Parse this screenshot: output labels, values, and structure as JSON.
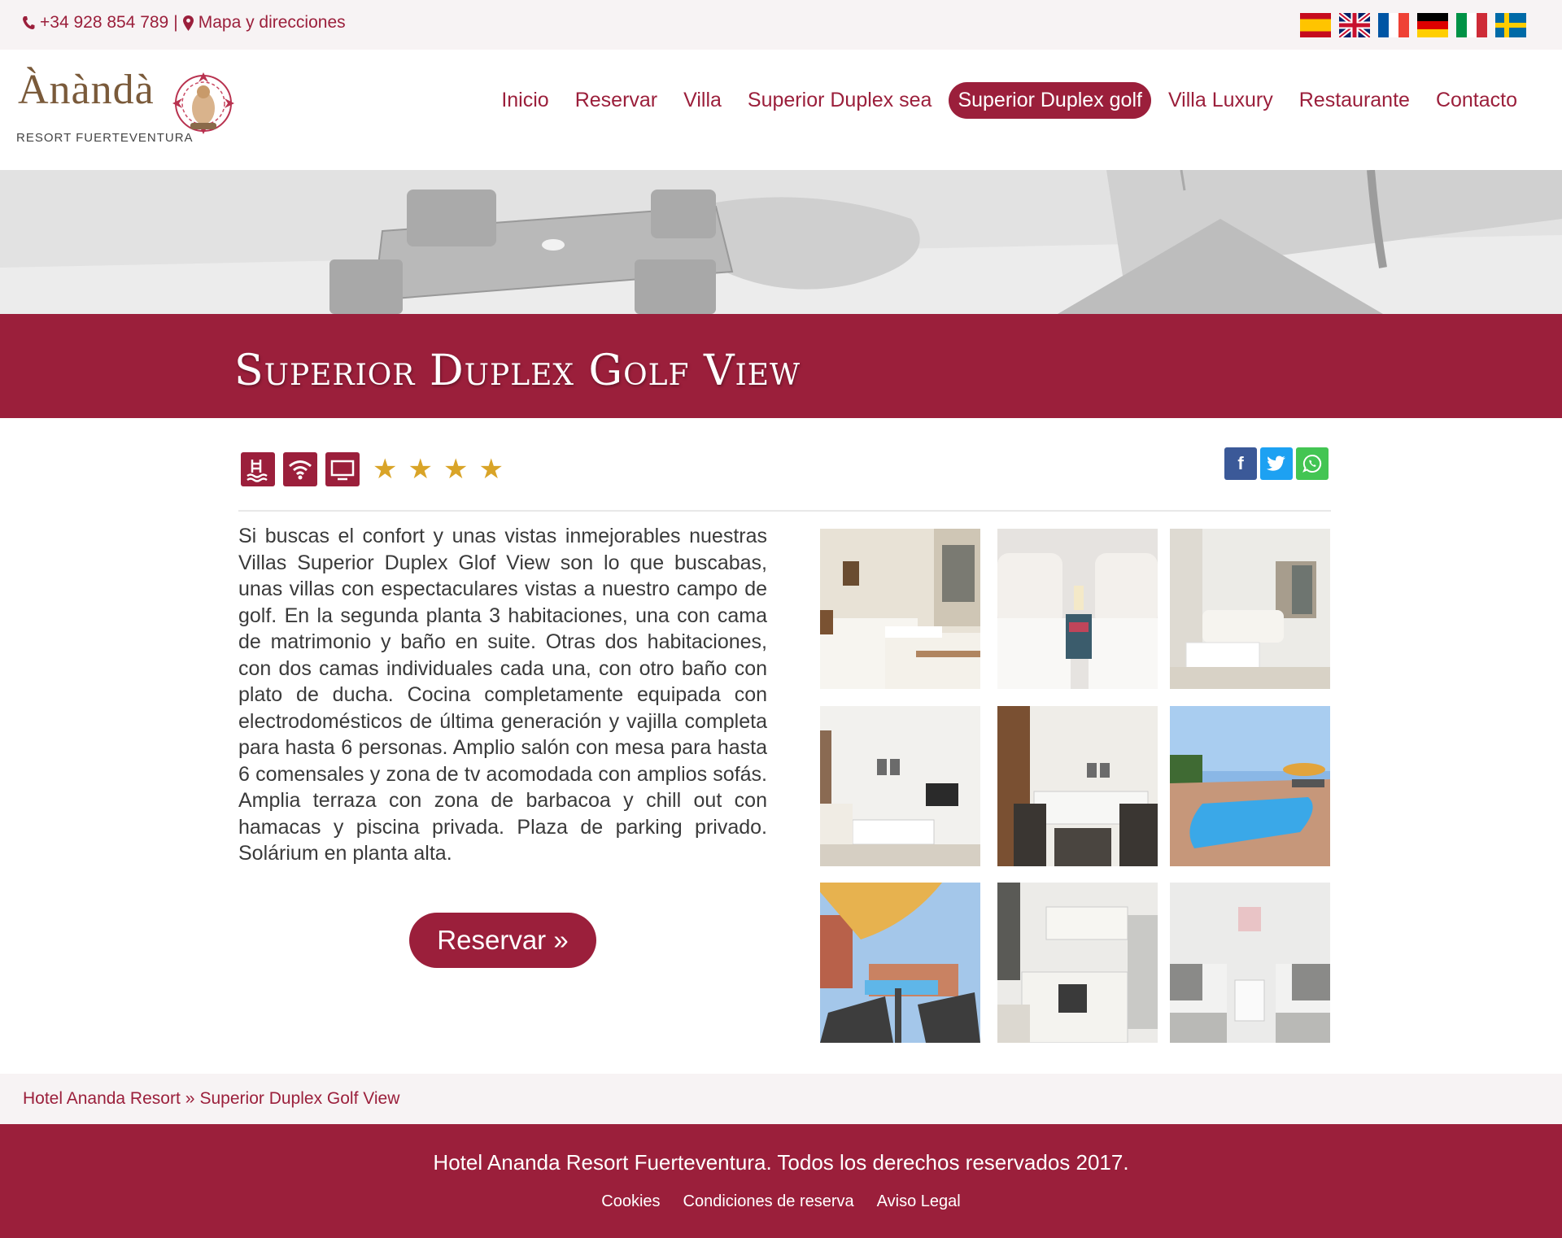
{
  "topbar": {
    "phone": "+34 928 854 789",
    "separator": "|",
    "map_link": "Mapa y direcciones",
    "languages": [
      "es",
      "en",
      "fr",
      "de",
      "it",
      "sv"
    ]
  },
  "logo": {
    "name": "Ànàndà",
    "subtitle": "RESORT FUERTEVENTURA"
  },
  "nav": {
    "items": [
      {
        "label": "Inicio"
      },
      {
        "label": "Reservar"
      },
      {
        "label": "Villa"
      },
      {
        "label": "Superior Duplex sea"
      },
      {
        "label": "Superior Duplex golf"
      },
      {
        "label": "Villa Luxury"
      },
      {
        "label": "Restaurante"
      },
      {
        "label": "Contacto"
      }
    ],
    "active": "Superior Duplex golf"
  },
  "page": {
    "title": "Superior Duplex Golf View",
    "amenities": [
      "pool-icon",
      "wifi-icon",
      "tv-icon"
    ],
    "rating": 4,
    "share": [
      "facebook-icon",
      "twitter-icon",
      "whatsapp-icon"
    ],
    "description": "Si buscas el confort y unas vistas inmejorables nuestras Villas Superior Duplex Glof View son lo que buscabas, unas villas con espectaculares vistas a nuestro campo de golf. En la segunda planta 3 habitaciones, una con cama de matrimonio y baño en suite. Otras dos habitaciones, con dos camas individuales cada una, con otro baño con plato de ducha. Cocina completamente equipada con electrodomésticos de última generación y vajilla completa para hasta 6 personas. Amplio salón con mesa para hasta 6 comensales y zona de tv acomodada con amplios sofás. Amplia terraza con zona de barbacoa y chill out con hamacas y piscina privada. Plaza de parking privado. Solárium en planta alta.",
    "reserve_button": "Reservar »"
  },
  "gallery": {
    "photos": [
      "bedroom-twin",
      "bedroom-headboard",
      "living-room",
      "lounge-tv",
      "dining-table",
      "private-pool",
      "terrace-parasol",
      "kitchen",
      "bedroom-single"
    ]
  },
  "breadcrumb": {
    "home": "Hotel Ananda Resort",
    "sep": "»",
    "current": "Superior Duplex Golf View"
  },
  "footer": {
    "copyright": "Hotel Ananda Resort Fuerteventura. Todos los derechos reservados 2017.",
    "links": [
      {
        "label": "Cookies"
      },
      {
        "label": "Condiciones de reserva"
      },
      {
        "label": "Aviso Legal"
      }
    ]
  },
  "colors": {
    "brand": "#9b1f3b",
    "star": "#d9a428",
    "facebook": "#3b5998",
    "twitter": "#1da1f2",
    "whatsapp": "#43c553"
  }
}
